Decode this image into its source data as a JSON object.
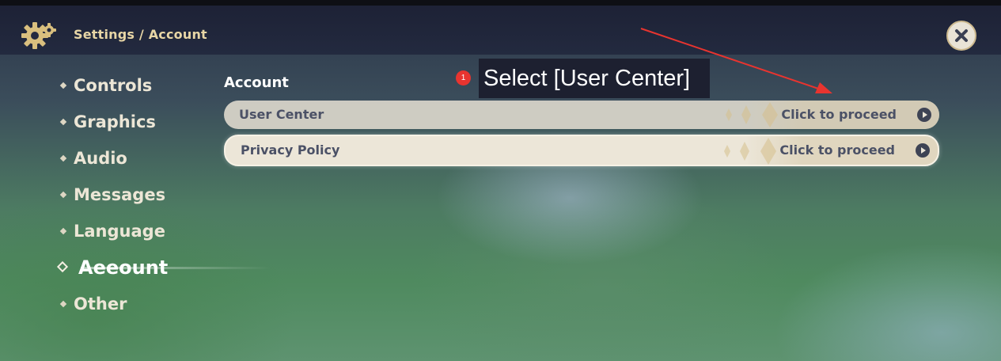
{
  "topbar": {
    "breadcrumb": "Settings / Account",
    "settings_icon": "gear-icon",
    "close_icon": "close-icon"
  },
  "sidebar": {
    "items": [
      {
        "label": "Controls"
      },
      {
        "label": "Graphics"
      },
      {
        "label": "Audio"
      },
      {
        "label": "Messages"
      },
      {
        "label": "Language"
      },
      {
        "label": "Aeeount",
        "active": true
      },
      {
        "label": "Other"
      }
    ]
  },
  "main": {
    "section_title": "Account",
    "rows": [
      {
        "label": "User Center",
        "action": "Click to proceed",
        "highlighted": false
      },
      {
        "label": "Privacy Policy",
        "action": "Click to proceed",
        "highlighted": true
      }
    ]
  },
  "annotation": {
    "step": "1",
    "text": "Select [User Center]",
    "color": "#e8342f"
  },
  "colors": {
    "accent_gold": "#e8d6a6",
    "row_text": "#4b5166",
    "annotation_red": "#e8342f"
  }
}
